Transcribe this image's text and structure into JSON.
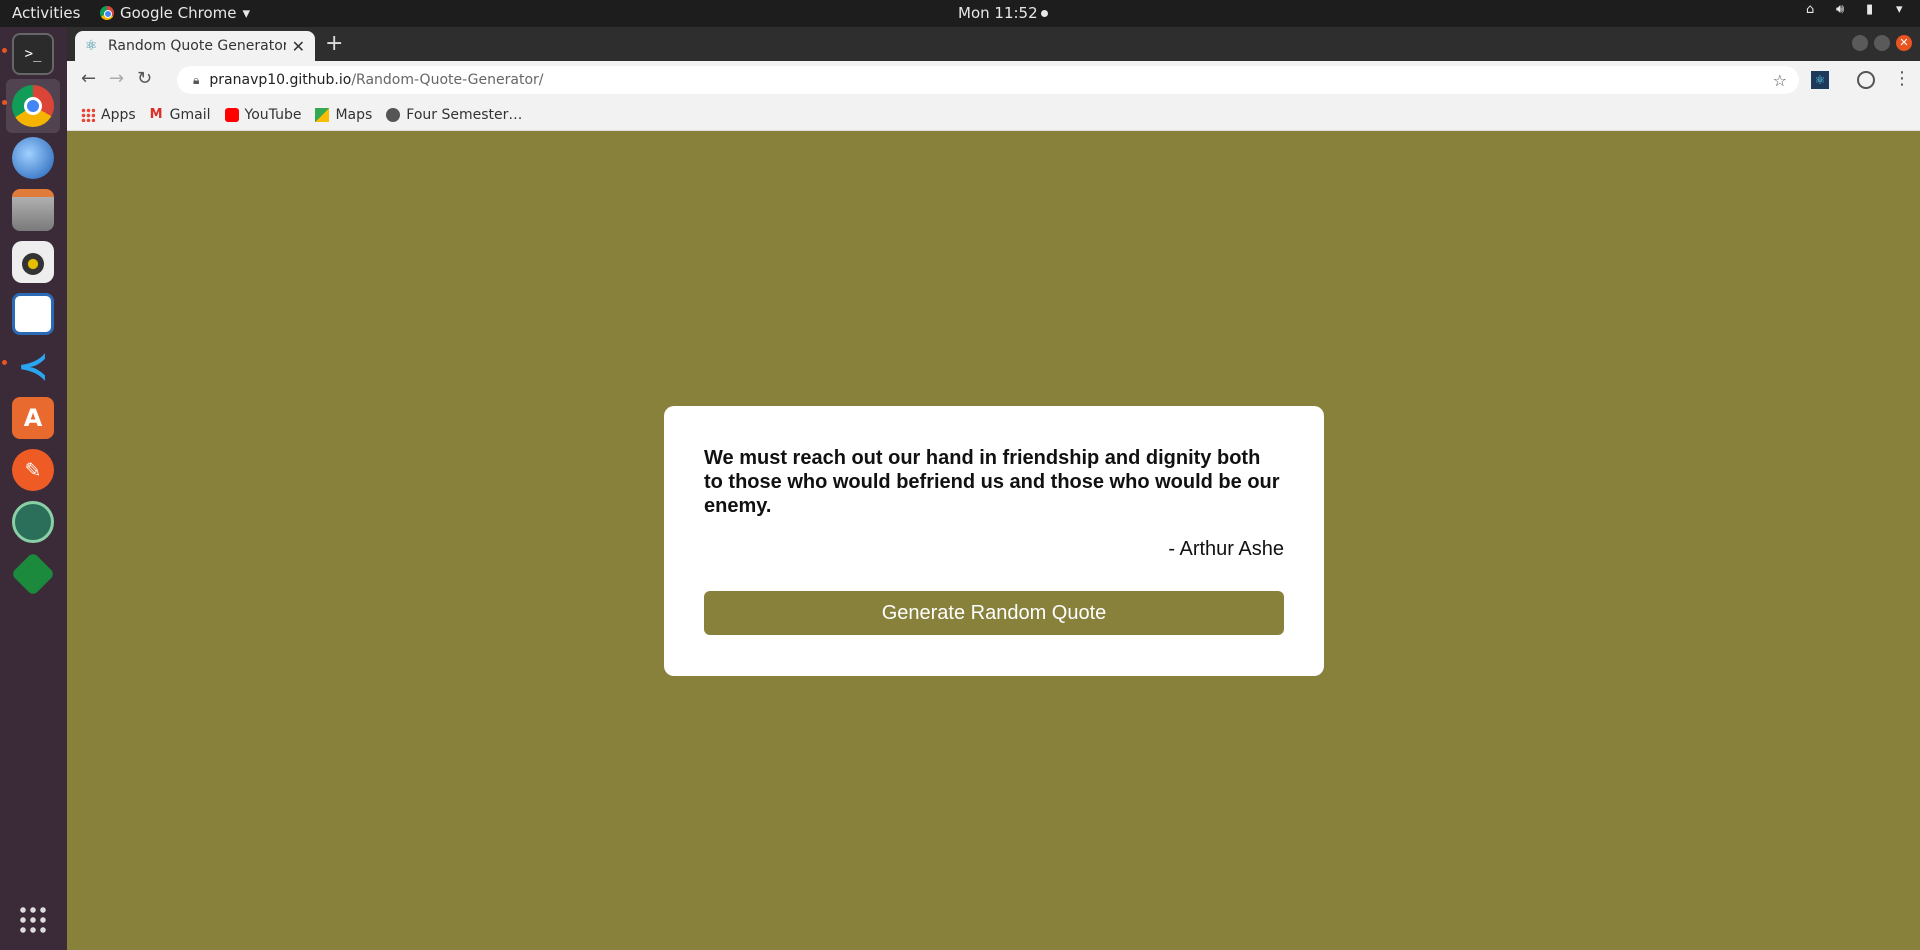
{
  "topbar": {
    "activities": "Activities",
    "app_name": "Google Chrome",
    "clock": "Mon 11:52"
  },
  "dock": {
    "items": [
      "terminal",
      "chrome",
      "thunderbird",
      "files",
      "rhythmbox",
      "libreoffice-writer",
      "vscode",
      "software-center",
      "postman",
      "android-studio",
      "vim"
    ]
  },
  "browser": {
    "tab_title": "Random Quote Generator",
    "url_host": "pranavp10.github.io",
    "url_path": "/Random-Quote-Generator/",
    "bookmarks": [
      "Apps",
      "Gmail",
      "YouTube",
      "Maps",
      "Four Semester…"
    ]
  },
  "page": {
    "background": "#87813b",
    "quote": "We must reach out our hand in friendship and dignity both to those who would befriend us and those who would be our enemy.",
    "author": "- Arthur Ashe",
    "button_label": "Generate Random Quote"
  }
}
